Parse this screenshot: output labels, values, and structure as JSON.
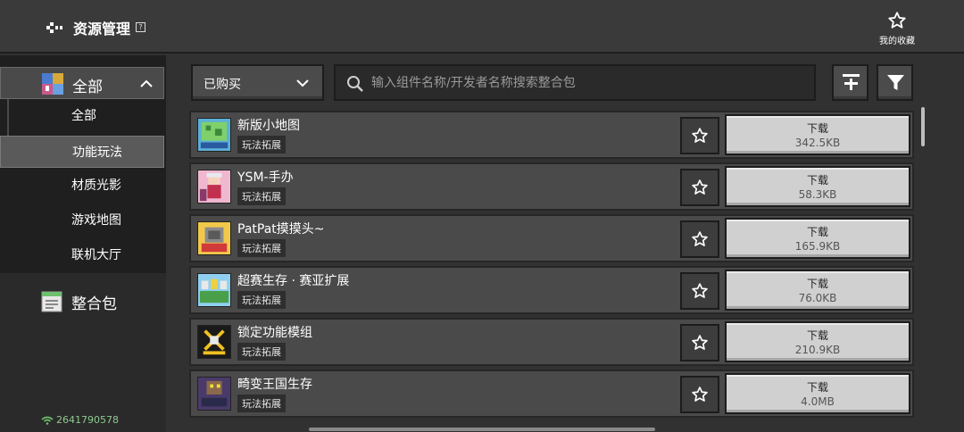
{
  "header": {
    "title": "资源管理",
    "help_glyph": "?",
    "favorites_label": "我的收藏"
  },
  "sidebar": {
    "category_title": "全部",
    "items": [
      {
        "label": "全部",
        "active": false
      },
      {
        "label": "功能玩法",
        "active": true
      },
      {
        "label": "材质光影",
        "active": false
      },
      {
        "label": "游戏地图",
        "active": false
      },
      {
        "label": "联机大厅",
        "active": false
      }
    ],
    "pack_label": "整合包",
    "network_id": "2641790578"
  },
  "toolbar": {
    "filter_selected": "已购买",
    "search_placeholder": "输入组件名称/开发者名称搜索整合包",
    "search_value": ""
  },
  "list": {
    "items": [
      {
        "name": "新版小地图",
        "tag": "玩法拓展",
        "download_label": "下载",
        "size": "342.5KB",
        "thumb": "map-thumb"
      },
      {
        "name": "YSM-手办",
        "tag": "玩法拓展",
        "download_label": "下载",
        "size": "58.3KB",
        "thumb": "figure-thumb"
      },
      {
        "name": "PatPat摸摸头~",
        "tag": "玩法拓展",
        "download_label": "下载",
        "size": "165.9KB",
        "thumb": "patpat-thumb"
      },
      {
        "name": "超赛生存 · 赛亚扩展",
        "tag": "玩法拓展",
        "download_label": "下载",
        "size": "76.0KB",
        "thumb": "survival-thumb"
      },
      {
        "name": "锁定功能模组",
        "tag": "玩法拓展",
        "download_label": "下载",
        "size": "210.9KB",
        "thumb": "lock-thumb"
      },
      {
        "name": "畸变王国生存",
        "tag": "玩法拓展",
        "download_label": "下载",
        "size": "4.0MB",
        "thumb": "kingdom-thumb"
      }
    ]
  },
  "colors": {
    "background": "#313131",
    "row": "#4a4a4a",
    "download_button": "#d0d0d0",
    "network_text": "#8ec98e"
  }
}
